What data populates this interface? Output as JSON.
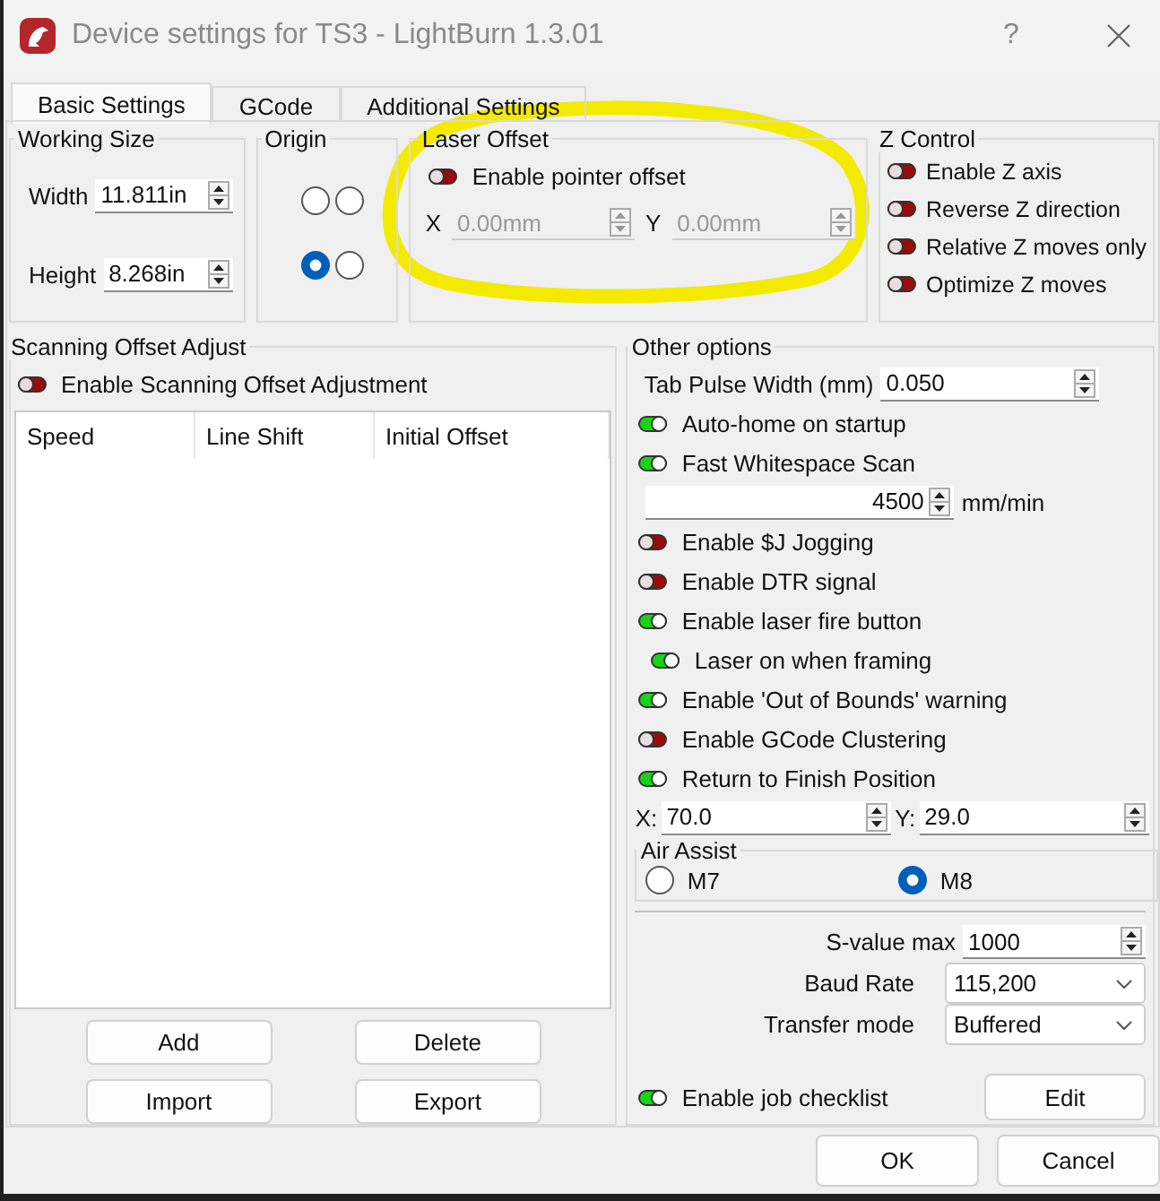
{
  "window": {
    "title": "Device settings for TS3 - LightBurn 1.3.01",
    "help": "?"
  },
  "tabs": [
    {
      "label": "Basic Settings",
      "selected": true
    },
    {
      "label": "GCode",
      "selected": false
    },
    {
      "label": "Additional Settings",
      "selected": false
    }
  ],
  "working_size": {
    "title": "Working Size",
    "fields": [
      {
        "label": "Width",
        "value": "11.811in"
      },
      {
        "label": "Height",
        "value": "8.268in"
      }
    ]
  },
  "origin": {
    "title": "Origin",
    "options": [
      {
        "selected": false
      },
      {
        "selected": false
      },
      {
        "selected": true
      },
      {
        "selected": false
      }
    ]
  },
  "laser_offset": {
    "title": "Laser Offset",
    "toggle": {
      "label": "Enable pointer offset",
      "on": false
    },
    "fields": [
      {
        "label": "X",
        "value": "0.00mm",
        "disabled": true
      },
      {
        "label": "Y",
        "value": "0.00mm",
        "disabled": true
      }
    ]
  },
  "z_control": {
    "title": "Z Control",
    "toggles": [
      {
        "label": "Enable Z axis",
        "on": false
      },
      {
        "label": "Reverse Z direction",
        "on": false
      },
      {
        "label": "Relative Z moves only",
        "on": false
      },
      {
        "label": "Optimize Z moves",
        "on": false
      }
    ]
  },
  "scanning": {
    "title": "Scanning Offset Adjust",
    "toggle": {
      "label": "Enable Scanning Offset Adjustment",
      "on": false
    },
    "columns": [
      "Speed",
      "Line Shift",
      "Initial Offset"
    ],
    "buttons": [
      "Add",
      "Delete",
      "Import",
      "Export"
    ]
  },
  "other_options": {
    "title": "Other options",
    "items": [
      {
        "kind": "spin",
        "label": "Tab Pulse Width (mm)",
        "value": "0.050"
      },
      {
        "kind": "toggle",
        "label": "Auto-home on startup",
        "on": true
      },
      {
        "kind": "toggle",
        "label": "Fast Whitespace Scan",
        "on": true
      },
      {
        "kind": "speed",
        "value": "4500",
        "unit": "mm/min"
      },
      {
        "kind": "toggle",
        "label": "Enable $J Jogging",
        "on": false
      },
      {
        "kind": "toggle",
        "label": "Enable DTR signal",
        "on": false
      },
      {
        "kind": "toggle",
        "label": "Enable laser fire button",
        "on": true,
        "children": [
          {
            "kind": "toggle",
            "label": "Laser on when framing",
            "on": true
          }
        ]
      },
      {
        "kind": "toggle",
        "label": "Enable 'Out of Bounds' warning",
        "on": true
      },
      {
        "kind": "toggle",
        "label": "Enable GCode Clustering",
        "on": false
      },
      {
        "kind": "toggle",
        "label": "Return to Finish Position",
        "on": true
      },
      {
        "kind": "xy",
        "fields": [
          {
            "label": "X:",
            "value": "70.0"
          },
          {
            "label": "Y:",
            "value": "29.0"
          }
        ]
      },
      {
        "kind": "radio_group",
        "title": "Air Assist",
        "options": [
          {
            "label": "M7",
            "selected": false
          },
          {
            "label": "M8",
            "selected": true
          }
        ]
      },
      {
        "kind": "form_spin",
        "label": "S-value max",
        "value": "1000"
      },
      {
        "kind": "combo",
        "label": "Baud Rate",
        "value": "115,200"
      },
      {
        "kind": "combo",
        "label": "Transfer mode",
        "value": "Buffered"
      },
      {
        "kind": "toggle_button",
        "label": "Enable job checklist",
        "on": true,
        "button": "Edit"
      }
    ]
  },
  "buttons": [
    "OK",
    "Cancel"
  ],
  "annotation": {
    "kind": "circle"
  }
}
